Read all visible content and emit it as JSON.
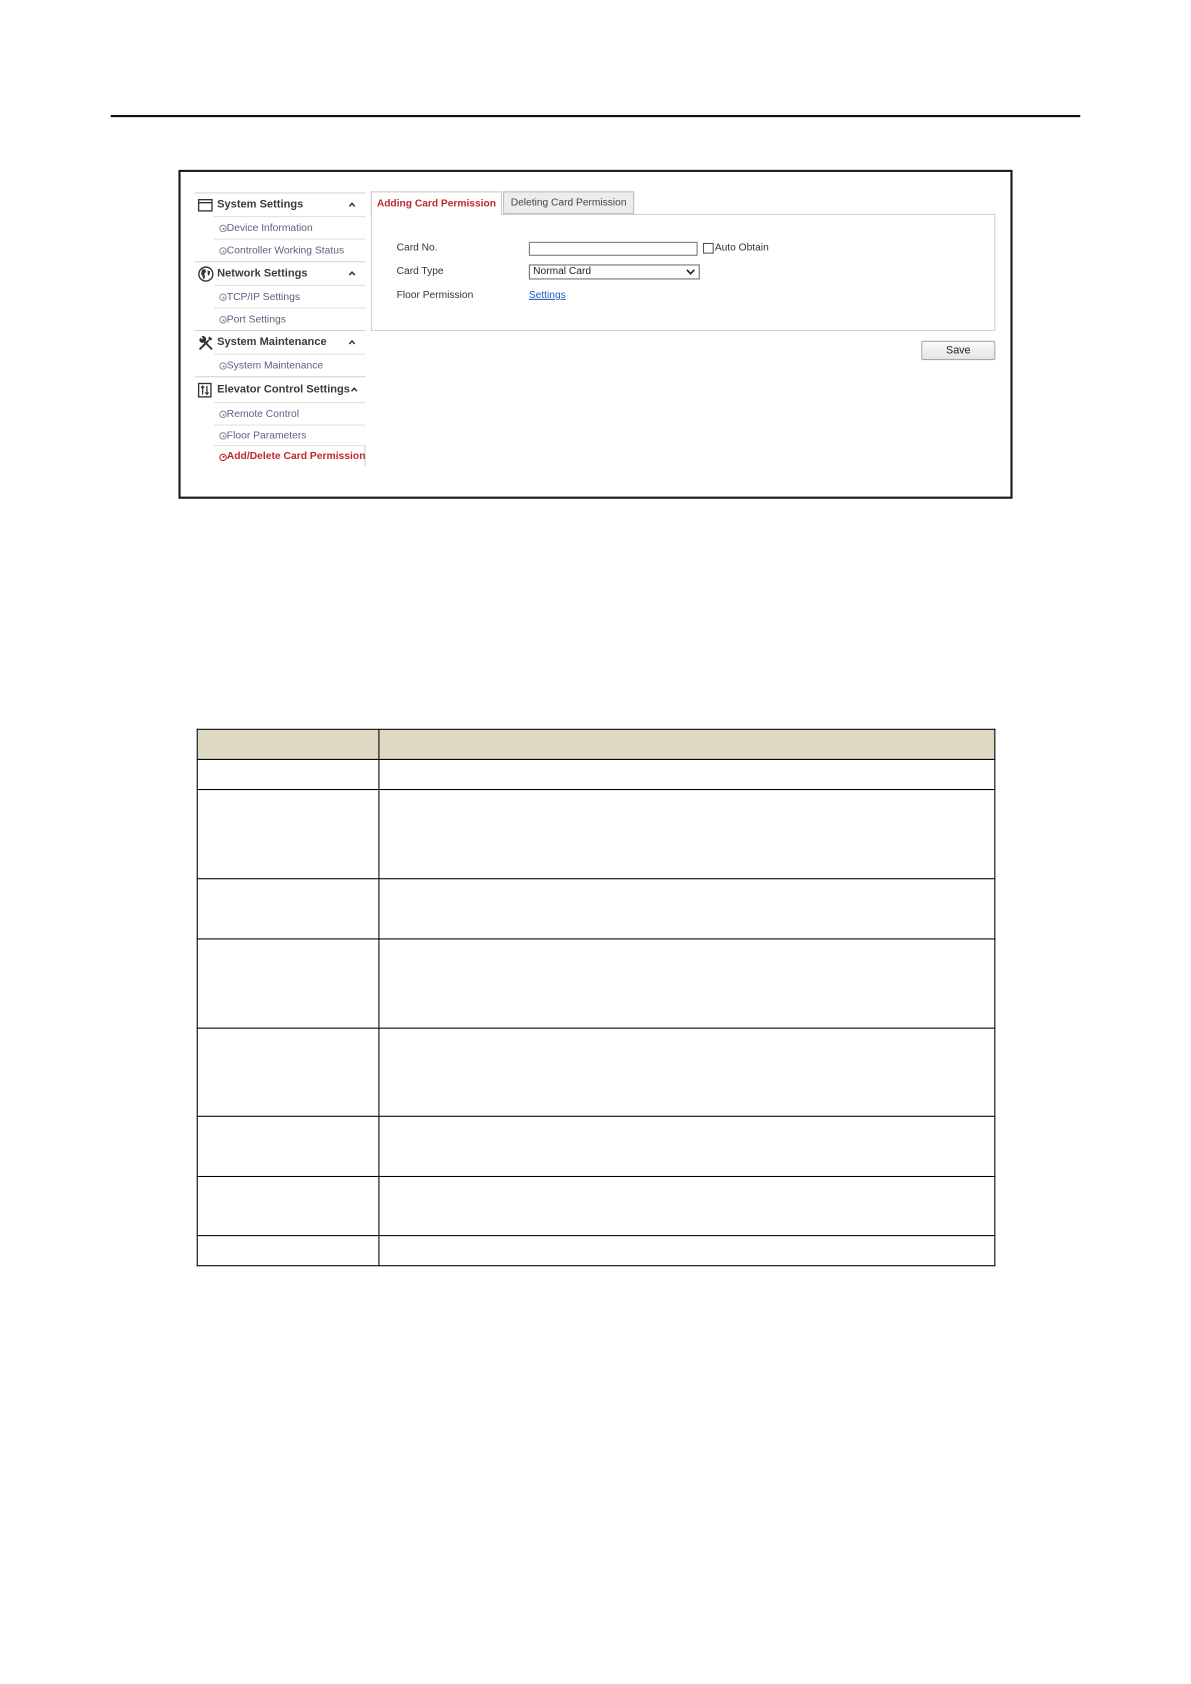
{
  "sidebar": {
    "sections": [
      {
        "label": "System Settings",
        "icon": "window-icon",
        "expanded": true,
        "items": [
          {
            "label": "Device Information",
            "active": false
          },
          {
            "label": "Controller Working Status",
            "active": false
          }
        ]
      },
      {
        "label": "Network Settings",
        "icon": "globe-icon",
        "expanded": true,
        "items": [
          {
            "label": "TCP/IP Settings",
            "active": false
          },
          {
            "label": "Port Settings",
            "active": false
          }
        ]
      },
      {
        "label": "System Maintenance",
        "icon": "tools-icon",
        "expanded": true,
        "items": [
          {
            "label": "System Maintenance",
            "active": false
          }
        ]
      },
      {
        "label": "Elevator Control Settings",
        "icon": "elevator-icon",
        "expanded": true,
        "items": [
          {
            "label": "Remote Control",
            "active": false
          },
          {
            "label": "Floor Parameters",
            "active": false
          },
          {
            "label": "Add/Delete Card Permission",
            "active": true
          }
        ]
      }
    ]
  },
  "tabs": [
    {
      "label": "Adding Card Permission",
      "active": true
    },
    {
      "label": "Deleting Card Permission",
      "active": false
    }
  ],
  "form": {
    "card_no": {
      "label": "Card No.",
      "value": ""
    },
    "auto_obtain": {
      "label": "Auto Obtain",
      "checked": false
    },
    "card_type": {
      "label": "Card Type",
      "value": "Normal Card"
    },
    "floor_permission": {
      "label": "Floor Permission",
      "link_text": "Settings"
    }
  },
  "actions": {
    "save_label": "Save"
  },
  "colors": {
    "active_accent": "#c1272d",
    "link": "#1f5fbf",
    "sub_item_text": "#59637f",
    "table_header_bg": "#ddd9c3"
  }
}
